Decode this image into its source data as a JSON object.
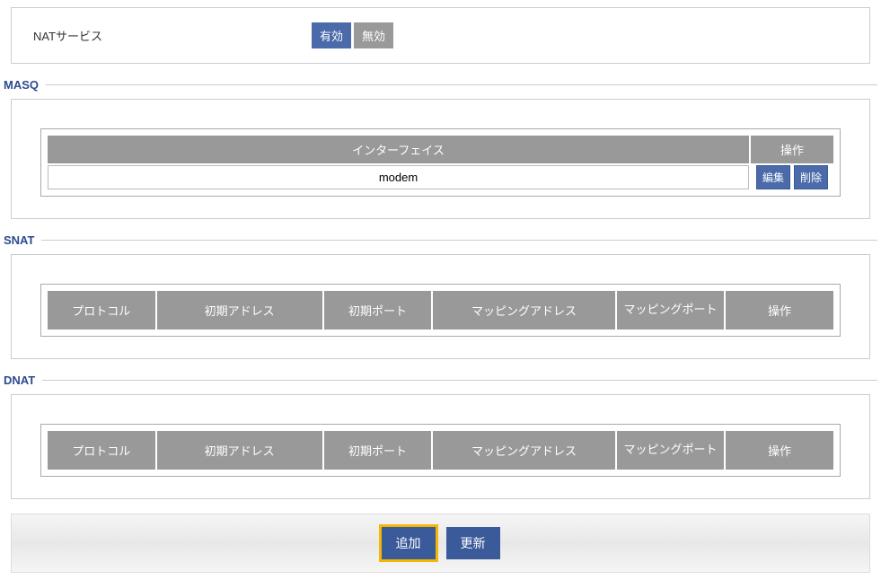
{
  "natService": {
    "label": "NATサービス",
    "enabledLabel": "有効",
    "disabledLabel": "無効"
  },
  "sections": {
    "masq": "MASQ",
    "snat": "SNAT",
    "dnat": "DNAT"
  },
  "masqTable": {
    "headers": {
      "interface": "インターフェイス",
      "action": "操作"
    },
    "rows": [
      {
        "interface": "modem"
      }
    ],
    "editLabel": "編集",
    "deleteLabel": "削除"
  },
  "natTable": {
    "headers": {
      "protocol": "プロトコル",
      "initAddress": "初期アドレス",
      "initPort": "初期ポート",
      "mapAddress": "マッピングアドレス",
      "mapPort": "マッピングポート",
      "action": "操作"
    }
  },
  "footer": {
    "addLabel": "追加",
    "updateLabel": "更新"
  }
}
